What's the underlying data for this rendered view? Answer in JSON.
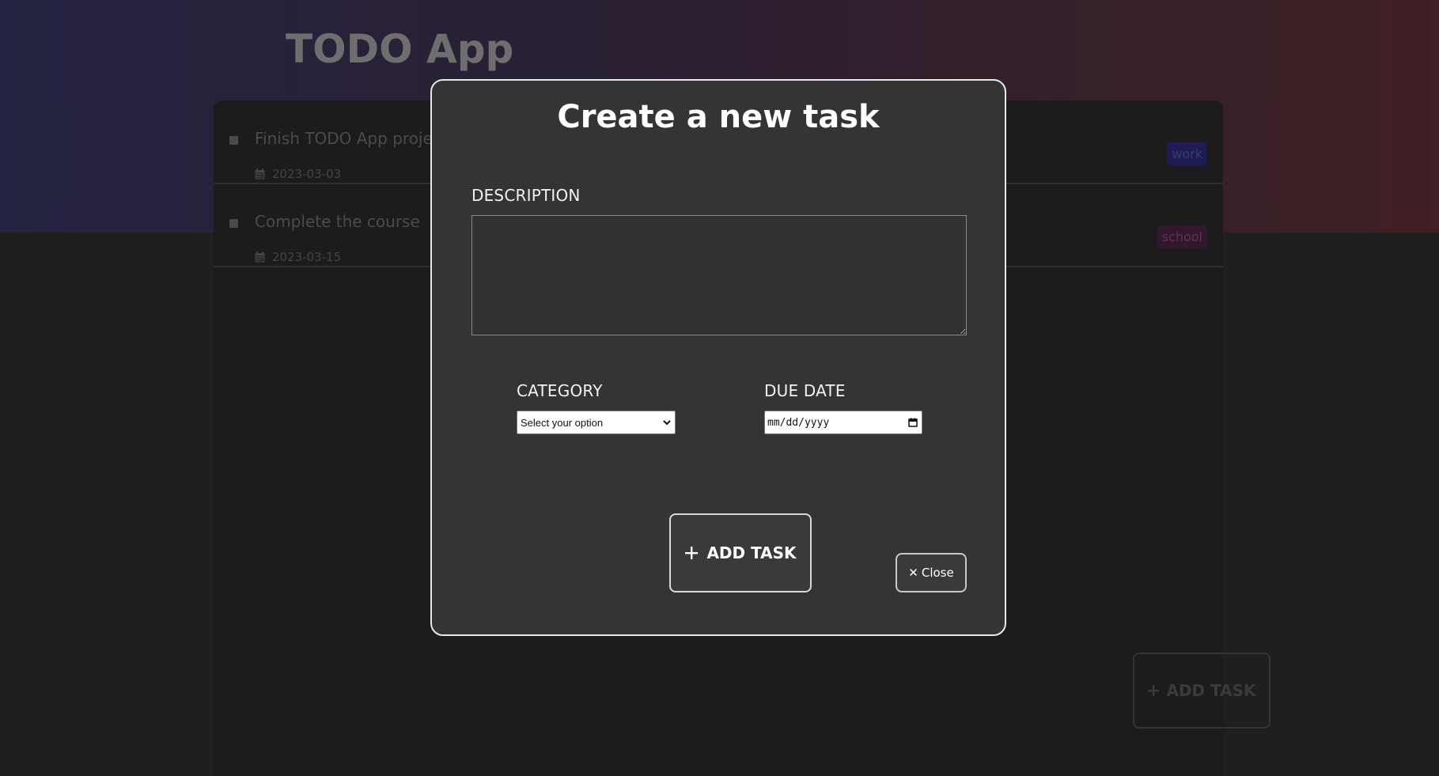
{
  "app": {
    "title": "TODO App"
  },
  "tasks": [
    {
      "description": "Finish TODO App project",
      "date": "2023-03-03",
      "category": "work"
    },
    {
      "description": "Complete the course",
      "date": "2023-03-15",
      "category": "school"
    }
  ],
  "background_add_button": {
    "label": "ADD TASK",
    "icon": "plus-icon"
  },
  "modal": {
    "title": "Create a new task",
    "description_label": "DESCRIPTION",
    "description_value": "",
    "category_label": "CATEGORY",
    "category_selected": "Select your option",
    "due_date_label": "DUE DATE",
    "due_date_placeholder": "mm/dd/yyyy",
    "add_button_label": "ADD TASK",
    "close_button_label": "Close",
    "close_icon_glyph": "✕"
  },
  "colors": {
    "banner_left": "#232341",
    "banner_right": "#3f2024",
    "modal_bg": "#343434",
    "modal_border": "#e8e8e8",
    "tag_work_bg": "#1e1c55",
    "tag_school_bg": "#33172f"
  }
}
